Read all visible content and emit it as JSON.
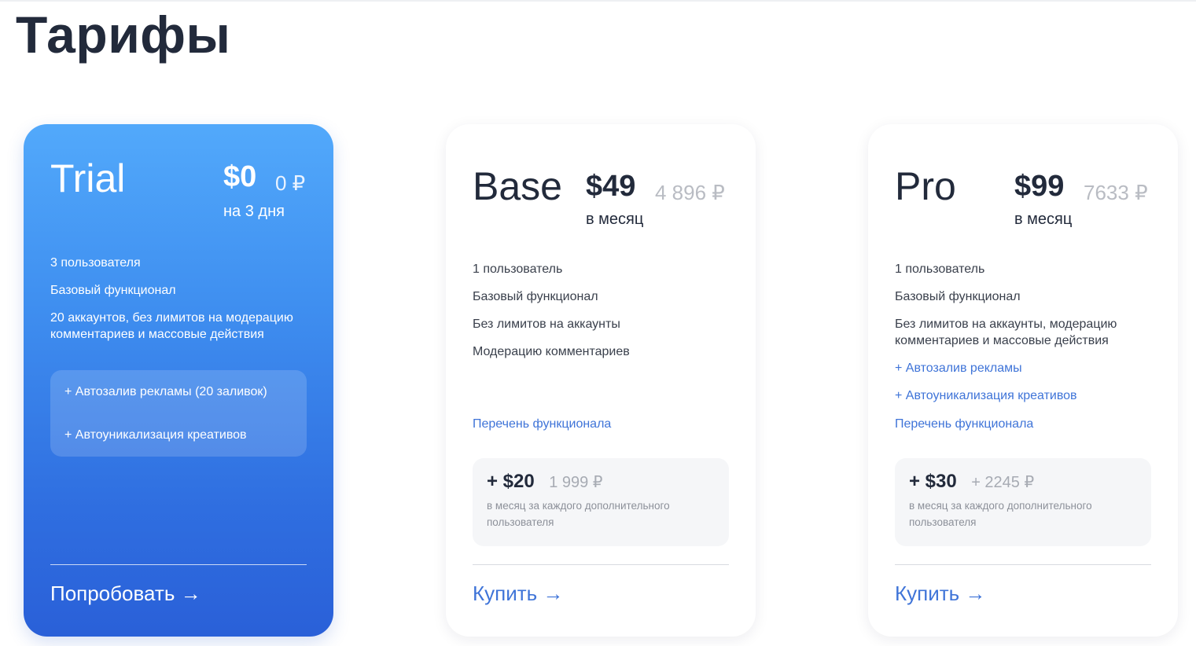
{
  "page": {
    "title": "Тарифы"
  },
  "plans": {
    "trial": {
      "name": "Trial",
      "price_usd": "$0",
      "price_rub": "0 ₽",
      "period": "на 3 дня",
      "features": [
        "3 пользователя",
        "Базовый функционал",
        "20 аккаунтов, без лимитов на модерацию комментариев и массовые действия"
      ],
      "addons": [
        "+ Автозалив рекламы (20 заливок)",
        "+ Автоуникализация креативов"
      ],
      "cta": "Попробовать →"
    },
    "base": {
      "name": "Base",
      "price_usd": "$49",
      "price_rub": "4 896 ₽",
      "period": "в месяц",
      "features": [
        "1 пользователь",
        "Базовый функционал",
        "Без лимитов на аккаунты",
        "Модерацию комментариев"
      ],
      "functional_link": "Перечень функционала",
      "extra_user": {
        "price": "+ $20",
        "rub": "1 999 ₽",
        "note": "в месяц за каждого дополнительного пользователя"
      },
      "cta": "Купить →"
    },
    "pro": {
      "name": "Pro",
      "price_usd": "$99",
      "price_rub": "7633 ₽",
      "period": "в месяц",
      "features": [
        "1 пользователь",
        "Базовый функционал",
        "Без лимитов на аккаунты, модерацию комментариев и массовые действия"
      ],
      "extras": [
        "+ Автозалив рекламы",
        "+ Автоуникализация креативов"
      ],
      "functional_link": "Перечень функционала",
      "extra_user": {
        "price": "+ $30",
        "rub": "+ 2245 ₽",
        "note": "в месяц за каждого дополнительного пользователя"
      },
      "cta": "Купить →"
    }
  },
  "colors": {
    "accent": "#3f74d8",
    "text": "#222a3b",
    "trial_gradient_top": "#52a9fb",
    "trial_gradient_bottom": "#2a60d8"
  }
}
